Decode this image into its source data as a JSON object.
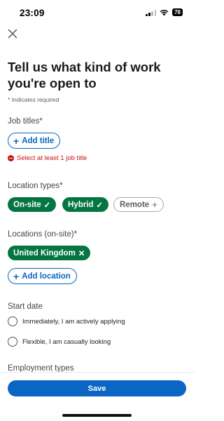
{
  "status_bar": {
    "time": "23:09",
    "battery": "78"
  },
  "header": {
    "close_icon": "close-icon"
  },
  "title": "Tell us what kind of work you're open to",
  "required_note": "* Indicates required",
  "job_titles": {
    "label": "Job titles*",
    "add_label": "Add title",
    "error": "Select at least 1 job title"
  },
  "location_types": {
    "label": "Location types*",
    "options": [
      {
        "label": "On-site",
        "selected": true
      },
      {
        "label": "Hybrid",
        "selected": true
      },
      {
        "label": "Remote",
        "selected": false
      }
    ]
  },
  "locations": {
    "label": "Locations (on-site)*",
    "selected": [
      "United Kingdom"
    ],
    "add_label": "Add location"
  },
  "start_date": {
    "label": "Start date",
    "options": [
      "Immediately, I am actively applying",
      "Flexible, I am casually looking"
    ]
  },
  "employment_types": {
    "label": "Employment types"
  },
  "footer": {
    "save_label": "Save"
  },
  "colors": {
    "primary": "#0a66c2",
    "selected_chip": "#057642",
    "error": "#cc1016"
  }
}
